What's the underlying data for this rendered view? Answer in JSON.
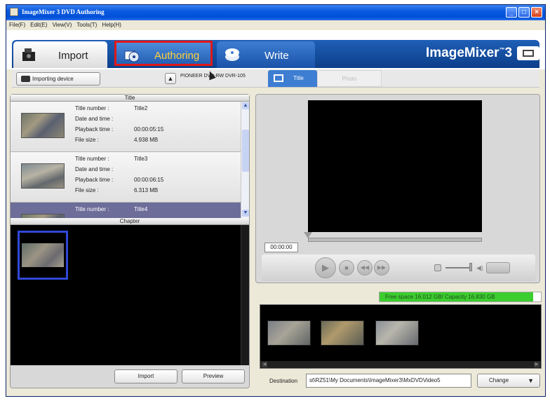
{
  "window": {
    "title": "ImageMixer 3 DVD Authoring",
    "controls": [
      "minimize",
      "maximize",
      "close"
    ]
  },
  "menu": [
    "File(F)",
    "Edit(E)",
    "View(V)",
    "Tools(T)",
    "Help(H)"
  ],
  "tabs": {
    "import": "Import",
    "authoring": "Authoring",
    "write": "Write",
    "active": "Authoring",
    "highlight_color": "#e01818"
  },
  "brand": {
    "name": "ImageMixer",
    "version": "3"
  },
  "toolbar": {
    "importing_device": "Importing device",
    "drive": "PIONEER DVD-RW DVR-105",
    "view_tabs": {
      "title": "Title",
      "photo": "Photo"
    }
  },
  "title_panel": {
    "header": "Title",
    "labels": {
      "title_number": "Title number :",
      "date_time": "Date and time :",
      "playback_time": "Playback time :",
      "file_size": "File size :"
    },
    "items": [
      {
        "title_number": "Title2",
        "date_time": "",
        "playback_time": "00:00:05:15",
        "file_size": "4.938 MB",
        "selected": false
      },
      {
        "title_number": "Title3",
        "date_time": "",
        "playback_time": "00:00:06:15",
        "file_size": "6.313 MB",
        "selected": false
      },
      {
        "title_number": "Title4",
        "date_time": "",
        "playback_time": "",
        "file_size": "",
        "selected": true
      }
    ]
  },
  "chapter_panel": {
    "header": "Chapter",
    "import_button": "Import",
    "preview_button": "Preview"
  },
  "player": {
    "timecode": "00:00:00",
    "progress": 0,
    "volume": 1.0
  },
  "disc_space": {
    "text": "Free space 16.012 GB/ Capacity 16.830 GB",
    "free_gb": 16.012,
    "capacity_gb": 16.83,
    "fill_color": "#3ccd2e"
  },
  "storyboard": {
    "clip_count": 3
  },
  "destination": {
    "label": "Destination",
    "path": "st\\RZ51\\My Documents\\ImageMixer3\\MxDVDVideo5",
    "change_button": "Change"
  }
}
